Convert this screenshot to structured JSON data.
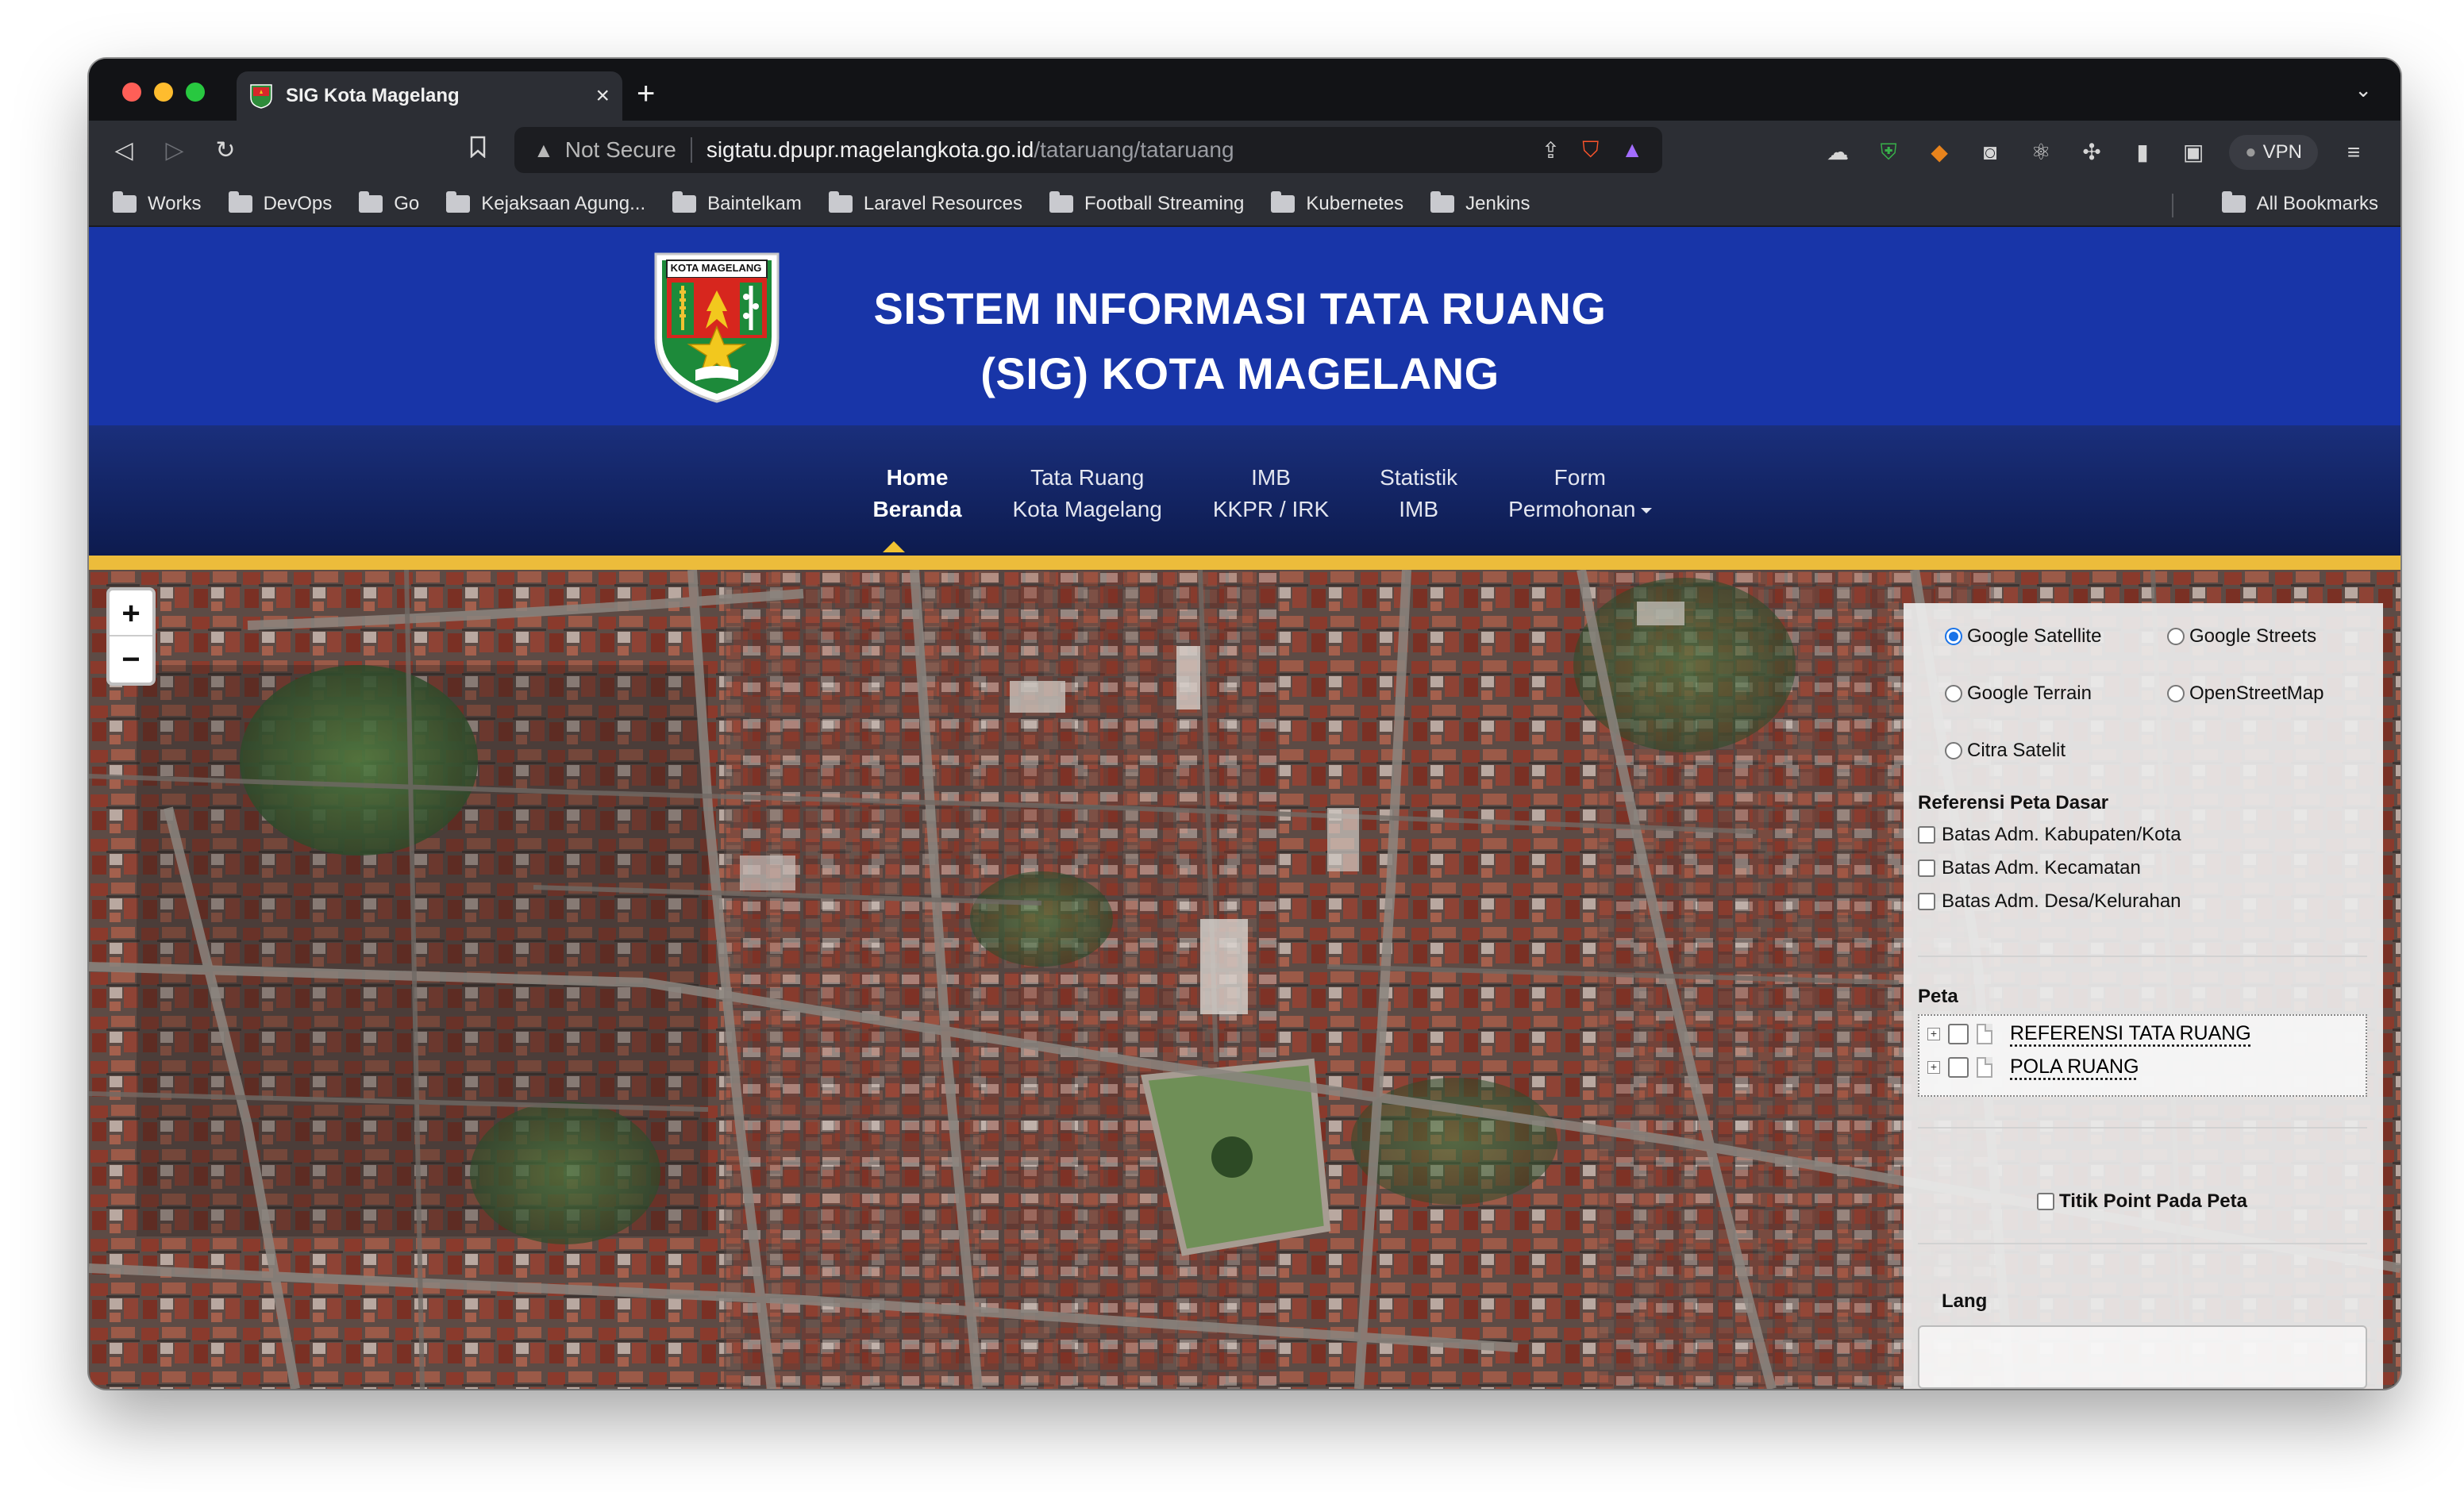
{
  "browser": {
    "tab_title": "SIG Kota Magelang",
    "url_security": "Not Secure",
    "url_host": "sigtatu.dpupr.magelangkota.go.id",
    "url_path": "/tataruang/tataruang",
    "vpn_label": "VPN",
    "bookmarks": [
      "Works",
      "DevOps",
      "Go",
      "Kejaksaan Agung...",
      "Baintelkam",
      "Laravel Resources",
      "Football Streaming",
      "Kubernetes",
      "Jenkins"
    ],
    "all_bookmarks": "All Bookmarks"
  },
  "header": {
    "title_line1": "SISTEM INFORMASI TATA RUANG",
    "title_line2": "(SIG) KOTA MAGELANG",
    "logo_text": "KOTA MAGELANG"
  },
  "nav": [
    {
      "line1": "Home",
      "line2": "Beranda"
    },
    {
      "line1": "Tata Ruang",
      "line2": "Kota Magelang"
    },
    {
      "line1": "IMB",
      "line2": "KKPR / IRK"
    },
    {
      "line1": "Statistik",
      "line2": "IMB"
    },
    {
      "line1": "Form",
      "line2": "Permohonan"
    }
  ],
  "map": {
    "zoom_in": "+",
    "zoom_out": "−"
  },
  "panel": {
    "basemaps": {
      "google_satellite": "Google Satellite",
      "google_streets": "Google Streets",
      "google_terrain": "Google Terrain",
      "openstreetmap": "OpenStreetMap",
      "citra_satelit": "Citra Satelit"
    },
    "referensi_title": "Referensi Peta Dasar",
    "referensi_items": [
      "Batas Adm. Kabupaten/Kota",
      "Batas Adm. Kecamatan",
      "Batas Adm. Desa/Kelurahan"
    ],
    "peta_title": "Peta",
    "peta_layers": [
      "REFERENSI TATA RUANG",
      "POLA RUANG"
    ],
    "titik_label": "Titik Point Pada Peta",
    "lang_title": "Lang"
  },
  "colors": {
    "header_blue": "#1835a8",
    "nav_dark": "#0d1b4e",
    "gold_bar": "#ecbc3b"
  }
}
